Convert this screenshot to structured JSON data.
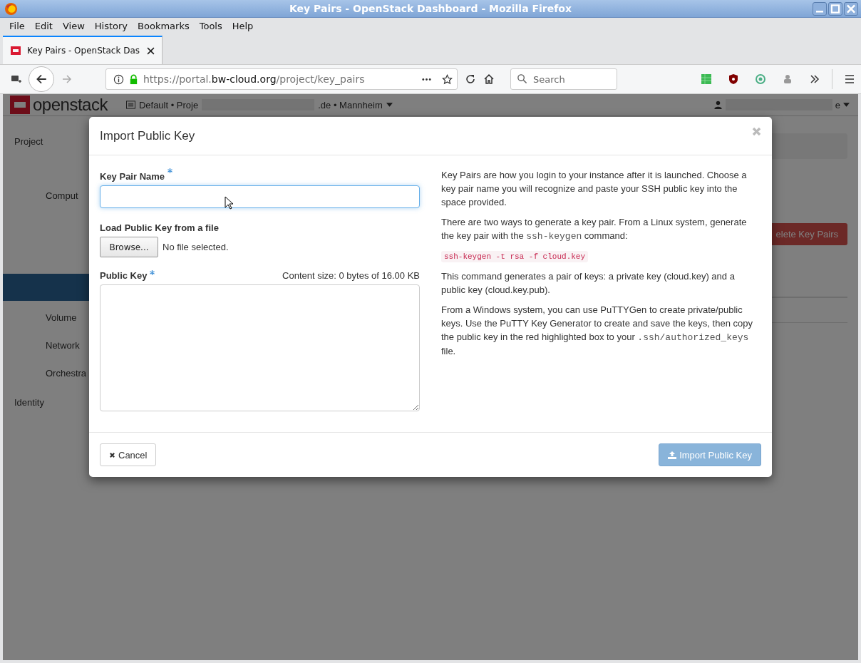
{
  "window": {
    "title": "Key Pairs - OpenStack Dashboard - Mozilla Firefox"
  },
  "menu": [
    "File",
    "Edit",
    "View",
    "History",
    "Bookmarks",
    "Tools",
    "Help"
  ],
  "tabs": [
    {
      "label": "Key Pairs - OpenStack Das",
      "selected": true
    }
  ],
  "address": {
    "prefix": "https://portal.",
    "domain": "bw-cloud.org",
    "path": "/project/key_pairs"
  },
  "search": {
    "placeholder": "Search"
  },
  "page": {
    "logo": "openstack",
    "project_prefix": "Default • Proje",
    "project_suffix": ".de • Mannheim",
    "user_suffix": "e",
    "sidebar": [
      {
        "label": "Project",
        "kind": "panel",
        "selected": false
      },
      {
        "label": "Comput",
        "kind": "group",
        "selected": false
      },
      {
        "kind": "item",
        "selected": true
      },
      {
        "label": "Volume",
        "kind": "group",
        "selected": false
      },
      {
        "label": "Network",
        "kind": "group",
        "selected": false
      },
      {
        "label": "Orchestra",
        "kind": "group",
        "selected": false
      },
      {
        "label": "Identity",
        "kind": "panel",
        "selected": false
      }
    ],
    "delete_button": "elete Key Pairs"
  },
  "modal": {
    "title": "Import Public Key",
    "name_label": "Key Pair Name",
    "name_required": true,
    "file_label": "Load Public Key from a file",
    "browse": "Browse...",
    "file_status": "No file selected.",
    "key_label": "Public Key",
    "key_required": true,
    "content_size": "Content size: 0 bytes of 16.00 KB",
    "help": [
      [
        {
          "kind": "text",
          "text": "Key Pairs are how you login to your instance after it is launched. Choose a key pair name you will recognize and paste your SSH public key into the space provided."
        }
      ],
      [
        {
          "kind": "text",
          "text": "There are two ways to generate a key pair. From a Linux system, generate the key pair with the "
        },
        {
          "kind": "code",
          "text": "ssh-keygen"
        },
        {
          "kind": "text",
          "text": " command:"
        }
      ],
      [
        {
          "kind": "block",
          "text": "ssh-keygen -t rsa -f cloud.key"
        }
      ],
      [
        {
          "kind": "text",
          "text": "This command generates a pair of keys: a private key (cloud.key) and a public key (cloud.key.pub)."
        }
      ],
      [
        {
          "kind": "text",
          "text": "From a Windows system, you can use PuTTYGen to create private/public keys. Use the PuTTY Key Generator to create and save the keys, then copy the public key in the red highlighted box to your "
        },
        {
          "kind": "code",
          "text": ".ssh/authorized_keys"
        },
        {
          "kind": "text",
          "text": " file."
        }
      ]
    ],
    "cancel": "Cancel",
    "submit": "Import Public Key",
    "submit_disabled": true
  }
}
